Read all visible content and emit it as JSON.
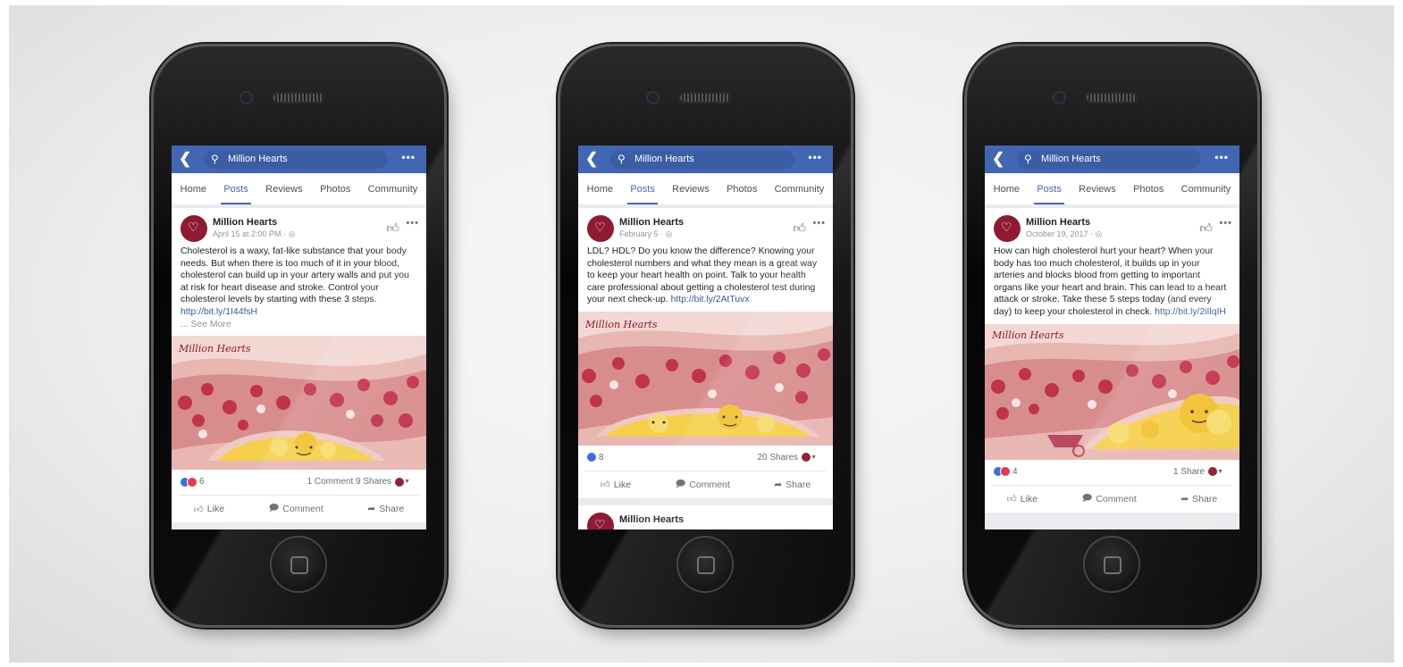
{
  "colors": {
    "fb_blue": "#4267b2",
    "link": "#385898",
    "brand": "#8e1b33",
    "artery": "#e8b7b2",
    "blood_cell": "#c0334b",
    "plaque": "#f5cf4a"
  },
  "phones": [
    {
      "search": {
        "icon": "search-icon",
        "text": "Million Hearts"
      },
      "tabs": [
        "Home",
        "Posts",
        "Reviews",
        "Photos",
        "Community"
      ],
      "active_tab": "Posts",
      "post": {
        "page_name": "Million Hearts",
        "date": "April 15 at 2:00 PM · ◎",
        "text": "Cholesterol is a waxy, fat-like substance that your body needs. But when there is too much of it in your blood, cholesterol can build up in your artery walls and put you at risk for heart disease and stroke. Control your cholesterol levels by starting with these 3 steps. ",
        "link": "http://bit.ly/1I44fsH",
        "see_more": "... See More",
        "art_logo": "Million Hearts",
        "reaction_count": "6",
        "stats": "1 Comment  9 Shares",
        "actions": [
          "Like",
          "Comment",
          "Share"
        ]
      }
    },
    {
      "search": {
        "icon": "search-icon",
        "text": "Million Hearts"
      },
      "tabs": [
        "Home",
        "Posts",
        "Reviews",
        "Photos",
        "Community"
      ],
      "active_tab": "Posts",
      "post": {
        "page_name": "Million Hearts",
        "date": "February 5 · ◎",
        "text": "LDL? HDL? Do you know the difference? Knowing your cholesterol numbers and what they mean is a great way to keep your heart health on point. Talk to your health care professional about getting a cholesterol test during your next check-up. ",
        "link": "http://bit.ly/2AtTuvx",
        "see_more": "",
        "art_logo": "Million Hearts",
        "reaction_count": "8",
        "stats": "20 Shares",
        "actions": [
          "Like",
          "Comment",
          "Share"
        ]
      },
      "next_post_name": "Million Hearts"
    },
    {
      "search": {
        "icon": "search-icon",
        "text": "Million Hearts"
      },
      "tabs": [
        "Home",
        "Posts",
        "Reviews",
        "Photos",
        "Community"
      ],
      "active_tab": "Posts",
      "post": {
        "page_name": "Million Hearts",
        "date": "October 19, 2017 · ◎",
        "text": "How can high cholesterol hurt your heart? When your body has too much cholesterol, it builds up in your arteries and blocks blood from getting to important organs like your heart and brain. This can lead to a heart attack or stroke. Take these 5 steps today (and every day) to keep your cholesterol in check. ",
        "link": "http://bit.ly/2iIlqIH",
        "see_more": "",
        "art_logo": "Million Hearts",
        "reaction_count": "4",
        "stats": "1 Share",
        "actions": [
          "Like",
          "Comment",
          "Share"
        ]
      }
    }
  ]
}
